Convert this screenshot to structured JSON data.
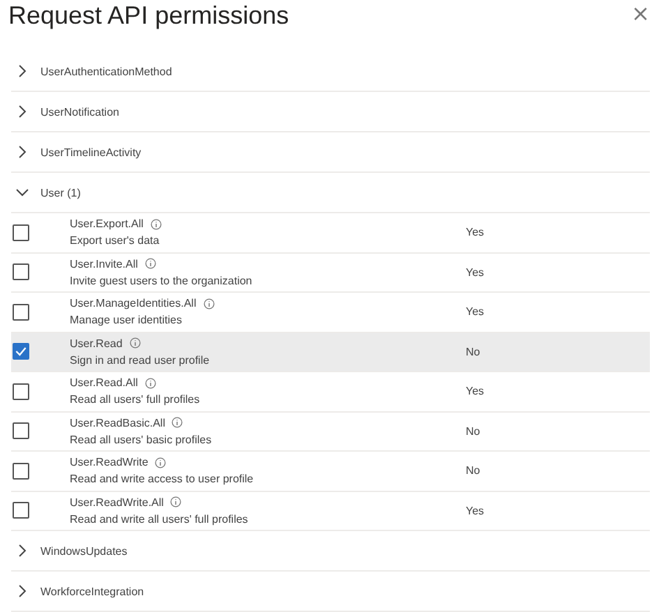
{
  "title": "Request API permissions",
  "close": "×",
  "groups": [
    {
      "name": "UserAuthenticationMethod",
      "expanded": false
    },
    {
      "name": "UserNotification",
      "expanded": false
    },
    {
      "name": "UserTimelineActivity",
      "expanded": false
    },
    {
      "name": "User (1)",
      "expanded": true,
      "permissions": [
        {
          "name": "User.Export.All",
          "description": "Export user's data",
          "admin_consent": "Yes",
          "checked": false
        },
        {
          "name": "User.Invite.All",
          "description": "Invite guest users to the organization",
          "admin_consent": "Yes",
          "checked": false
        },
        {
          "name": "User.ManageIdentities.All",
          "description": "Manage user identities",
          "admin_consent": "Yes",
          "checked": false
        },
        {
          "name": "User.Read",
          "description": "Sign in and read user profile",
          "admin_consent": "No",
          "checked": true
        },
        {
          "name": "User.Read.All",
          "description": "Read all users' full profiles",
          "admin_consent": "Yes",
          "checked": false
        },
        {
          "name": "User.ReadBasic.All",
          "description": "Read all users' basic profiles",
          "admin_consent": "No",
          "checked": false
        },
        {
          "name": "User.ReadWrite",
          "description": "Read and write access to user profile",
          "admin_consent": "No",
          "checked": false
        },
        {
          "name": "User.ReadWrite.All",
          "description": "Read and write all users' full profiles",
          "admin_consent": "Yes",
          "checked": false
        }
      ]
    },
    {
      "name": "WindowsUpdates",
      "expanded": false
    },
    {
      "name": "WorkforceIntegration",
      "expanded": false
    }
  ]
}
